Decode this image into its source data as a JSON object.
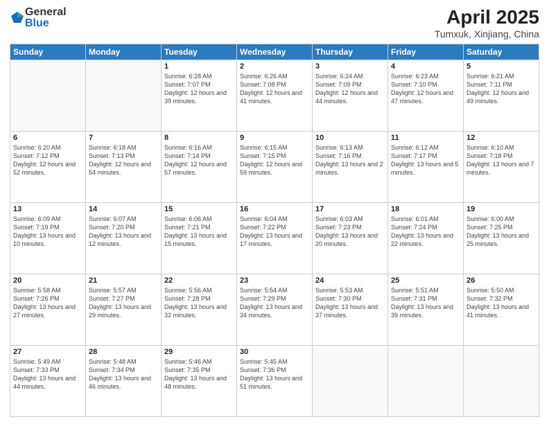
{
  "header": {
    "logo_general": "General",
    "logo_blue": "Blue",
    "title": "April 2025",
    "location": "Tumxuk, Xinjiang, China"
  },
  "weekdays": [
    "Sunday",
    "Monday",
    "Tuesday",
    "Wednesday",
    "Thursday",
    "Friday",
    "Saturday"
  ],
  "weeks": [
    [
      {
        "day": "",
        "sunrise": "",
        "sunset": "",
        "daylight": ""
      },
      {
        "day": "",
        "sunrise": "",
        "sunset": "",
        "daylight": ""
      },
      {
        "day": "1",
        "sunrise": "Sunrise: 6:28 AM",
        "sunset": "Sunset: 7:07 PM",
        "daylight": "Daylight: 12 hours and 39 minutes."
      },
      {
        "day": "2",
        "sunrise": "Sunrise: 6:26 AM",
        "sunset": "Sunset: 7:08 PM",
        "daylight": "Daylight: 12 hours and 41 minutes."
      },
      {
        "day": "3",
        "sunrise": "Sunrise: 6:24 AM",
        "sunset": "Sunset: 7:09 PM",
        "daylight": "Daylight: 12 hours and 44 minutes."
      },
      {
        "day": "4",
        "sunrise": "Sunrise: 6:23 AM",
        "sunset": "Sunset: 7:10 PM",
        "daylight": "Daylight: 12 hours and 47 minutes."
      },
      {
        "day": "5",
        "sunrise": "Sunrise: 6:21 AM",
        "sunset": "Sunset: 7:11 PM",
        "daylight": "Daylight: 12 hours and 49 minutes."
      }
    ],
    [
      {
        "day": "6",
        "sunrise": "Sunrise: 6:20 AM",
        "sunset": "Sunset: 7:12 PM",
        "daylight": "Daylight: 12 hours and 52 minutes."
      },
      {
        "day": "7",
        "sunrise": "Sunrise: 6:18 AM",
        "sunset": "Sunset: 7:13 PM",
        "daylight": "Daylight: 12 hours and 54 minutes."
      },
      {
        "day": "8",
        "sunrise": "Sunrise: 6:16 AM",
        "sunset": "Sunset: 7:14 PM",
        "daylight": "Daylight: 12 hours and 57 minutes."
      },
      {
        "day": "9",
        "sunrise": "Sunrise: 6:15 AM",
        "sunset": "Sunset: 7:15 PM",
        "daylight": "Daylight: 12 hours and 59 minutes."
      },
      {
        "day": "10",
        "sunrise": "Sunrise: 6:13 AM",
        "sunset": "Sunset: 7:16 PM",
        "daylight": "Daylight: 13 hours and 2 minutes."
      },
      {
        "day": "11",
        "sunrise": "Sunrise: 6:12 AM",
        "sunset": "Sunset: 7:17 PM",
        "daylight": "Daylight: 13 hours and 5 minutes."
      },
      {
        "day": "12",
        "sunrise": "Sunrise: 6:10 AM",
        "sunset": "Sunset: 7:18 PM",
        "daylight": "Daylight: 13 hours and 7 minutes."
      }
    ],
    [
      {
        "day": "13",
        "sunrise": "Sunrise: 6:09 AM",
        "sunset": "Sunset: 7:19 PM",
        "daylight": "Daylight: 13 hours and 10 minutes."
      },
      {
        "day": "14",
        "sunrise": "Sunrise: 6:07 AM",
        "sunset": "Sunset: 7:20 PM",
        "daylight": "Daylight: 13 hours and 12 minutes."
      },
      {
        "day": "15",
        "sunrise": "Sunrise: 6:06 AM",
        "sunset": "Sunset: 7:21 PM",
        "daylight": "Daylight: 13 hours and 15 minutes."
      },
      {
        "day": "16",
        "sunrise": "Sunrise: 6:04 AM",
        "sunset": "Sunset: 7:22 PM",
        "daylight": "Daylight: 13 hours and 17 minutes."
      },
      {
        "day": "17",
        "sunrise": "Sunrise: 6:03 AM",
        "sunset": "Sunset: 7:23 PM",
        "daylight": "Daylight: 13 hours and 20 minutes."
      },
      {
        "day": "18",
        "sunrise": "Sunrise: 6:01 AM",
        "sunset": "Sunset: 7:24 PM",
        "daylight": "Daylight: 13 hours and 22 minutes."
      },
      {
        "day": "19",
        "sunrise": "Sunrise: 6:00 AM",
        "sunset": "Sunset: 7:25 PM",
        "daylight": "Daylight: 13 hours and 25 minutes."
      }
    ],
    [
      {
        "day": "20",
        "sunrise": "Sunrise: 5:58 AM",
        "sunset": "Sunset: 7:26 PM",
        "daylight": "Daylight: 13 hours and 27 minutes."
      },
      {
        "day": "21",
        "sunrise": "Sunrise: 5:57 AM",
        "sunset": "Sunset: 7:27 PM",
        "daylight": "Daylight: 13 hours and 29 minutes."
      },
      {
        "day": "22",
        "sunrise": "Sunrise: 5:56 AM",
        "sunset": "Sunset: 7:28 PM",
        "daylight": "Daylight: 13 hours and 32 minutes."
      },
      {
        "day": "23",
        "sunrise": "Sunrise: 5:54 AM",
        "sunset": "Sunset: 7:29 PM",
        "daylight": "Daylight: 13 hours and 34 minutes."
      },
      {
        "day": "24",
        "sunrise": "Sunrise: 5:53 AM",
        "sunset": "Sunset: 7:30 PM",
        "daylight": "Daylight: 13 hours and 37 minutes."
      },
      {
        "day": "25",
        "sunrise": "Sunrise: 5:51 AM",
        "sunset": "Sunset: 7:31 PM",
        "daylight": "Daylight: 13 hours and 39 minutes."
      },
      {
        "day": "26",
        "sunrise": "Sunrise: 5:50 AM",
        "sunset": "Sunset: 7:32 PM",
        "daylight": "Daylight: 13 hours and 41 minutes."
      }
    ],
    [
      {
        "day": "27",
        "sunrise": "Sunrise: 5:49 AM",
        "sunset": "Sunset: 7:33 PM",
        "daylight": "Daylight: 13 hours and 44 minutes."
      },
      {
        "day": "28",
        "sunrise": "Sunrise: 5:48 AM",
        "sunset": "Sunset: 7:34 PM",
        "daylight": "Daylight: 13 hours and 46 minutes."
      },
      {
        "day": "29",
        "sunrise": "Sunrise: 5:46 AM",
        "sunset": "Sunset: 7:35 PM",
        "daylight": "Daylight: 13 hours and 48 minutes."
      },
      {
        "day": "30",
        "sunrise": "Sunrise: 5:45 AM",
        "sunset": "Sunset: 7:36 PM",
        "daylight": "Daylight: 13 hours and 51 minutes."
      },
      {
        "day": "",
        "sunrise": "",
        "sunset": "",
        "daylight": ""
      },
      {
        "day": "",
        "sunrise": "",
        "sunset": "",
        "daylight": ""
      },
      {
        "day": "",
        "sunrise": "",
        "sunset": "",
        "daylight": ""
      }
    ]
  ]
}
